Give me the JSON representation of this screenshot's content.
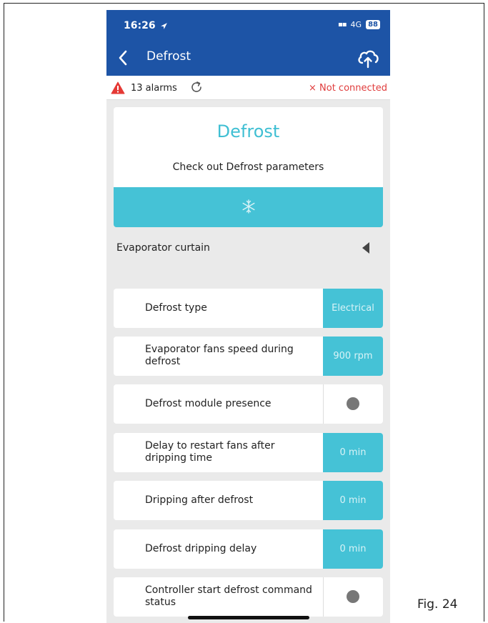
{
  "status_bar": {
    "time": "16:26",
    "network": "4G",
    "battery": "88"
  },
  "nav": {
    "title": "Defrost"
  },
  "alarm_bar": {
    "alarms": "13 alarms",
    "connection": "× Not connected"
  },
  "header": {
    "title": "Defrost",
    "subtitle": "Check out Defrost parameters"
  },
  "section": {
    "label": "Evaporator curtain"
  },
  "params": [
    {
      "label": "Defrost type",
      "value": "Electrical"
    },
    {
      "label": "Evaporator fans speed during defrost",
      "value": "900 rpm"
    },
    {
      "label": "Defrost module presence"
    },
    {
      "label": "Delay to restart fans after dripping time",
      "value": "0 min"
    },
    {
      "label": "Dripping after defrost",
      "value": "0 min"
    },
    {
      "label": "Defrost dripping delay",
      "value": "0 min"
    },
    {
      "label": "Controller start defrost command status"
    }
  ],
  "figure": {
    "caption": "Fig. 24"
  },
  "colors": {
    "nav_blue": "#1d54a6",
    "accent_teal": "#45c2d6",
    "alert_red": "#e03c3c"
  },
  "icons": [
    "location-arrow-icon",
    "signal-icon",
    "battery-icon",
    "back-chevron-icon",
    "cloud-upload-icon",
    "warning-icon",
    "refresh-icon",
    "snowflake-icon",
    "collapse-triangle-icon"
  ]
}
